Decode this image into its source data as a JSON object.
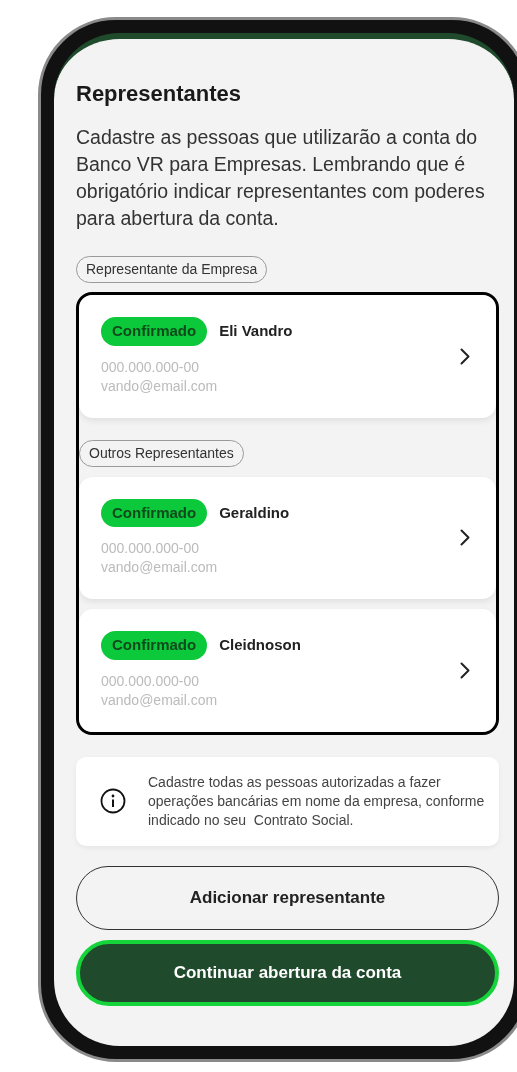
{
  "title": "Representantes",
  "description": "Cadastre as pessoas que utilizarão a conta do Banco VR para Empresas. Lembrando que é obrigatório indicar representantes com poderes para abertura da conta.",
  "sections": [
    {
      "label": "Representante da Empresa",
      "people": [
        {
          "status": "Confirmado",
          "name": "Eli Vandro",
          "document": "000.000.000-00",
          "email": "vando@email.com"
        }
      ]
    },
    {
      "label": "Outros Representantes",
      "people": [
        {
          "status": "Confirmado",
          "name": "Geraldino",
          "document": "000.000.000-00",
          "email": "vando@email.com"
        },
        {
          "status": "Confirmado",
          "name": "Cleidnoson",
          "document": "000.000.000-00",
          "email": "vando@email.com"
        }
      ]
    }
  ],
  "info": "Cadastre todas as pessoas autorizadas a fazer operações bancárias em nome da empresa, conforme indicado no seu  Contrato Social.",
  "buttons": [
    {
      "label": "Adicionar representante",
      "kind": "outline"
    },
    {
      "label": "Continuar abertura da conta",
      "kind": "primary"
    }
  ]
}
